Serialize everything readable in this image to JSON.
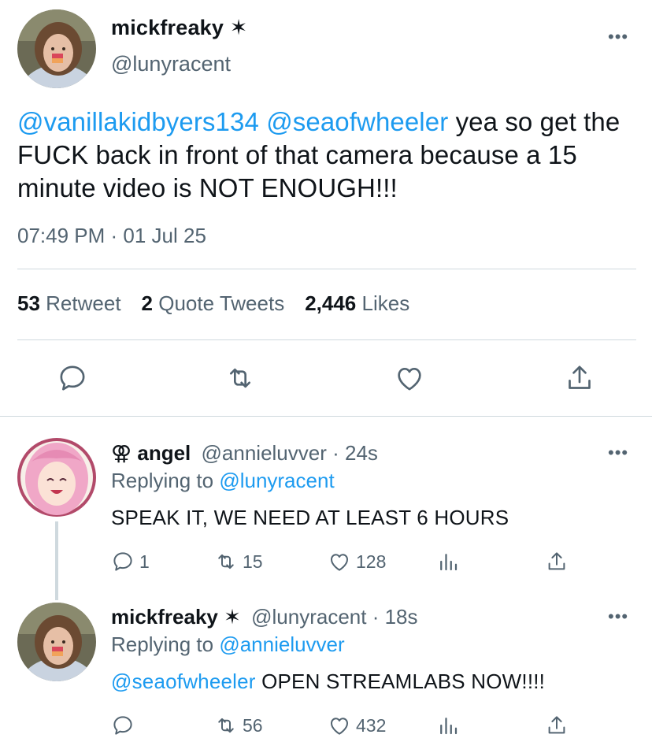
{
  "main_tweet": {
    "display_name": "mickfreaky ✶",
    "handle": "@lunyracent",
    "more": "•••",
    "text_mention_1": "@vanillakidbyers134",
    "text_mention_2": "@seaofwheeler",
    "text_rest": "yea so get the FUCK back in front of that camera because a 15 minute video is NOT ENOUGH!!!",
    "timestamp": "07:49 PM · 01 Jul 25",
    "stats": {
      "retweets_count": "53",
      "retweets_label": "Retweet",
      "quotes_count": "2",
      "quotes_label": "Quote Tweets",
      "likes_count": "2,446",
      "likes_label": "Likes"
    },
    "actions": [
      "reply-icon",
      "retweet-icon",
      "like-icon",
      "share-icon"
    ]
  },
  "replies": [
    {
      "display_name_icon": "⚢",
      "display_name": "angel",
      "handle": "@annieluvver",
      "time": "· 24s",
      "replying_prefix": "Replying to",
      "replying_to": "@lunyracent",
      "text_mention": "",
      "text": "SPEAK IT, WE NEED AT LEAST 6 HOURS",
      "reply_count": "1",
      "retweet_count": "15",
      "like_count": "128",
      "more": "•••"
    },
    {
      "display_name": "mickfreaky ✶",
      "handle": "@lunyracent",
      "time": "· 18s",
      "replying_prefix": "Replying to",
      "replying_to": "@annieluvver",
      "text_mention": "@seaofwheeler",
      "text": "OPEN STREAMLABS NOW!!!!",
      "reply_count": "",
      "retweet_count": "56",
      "like_count": "432",
      "more": "•••"
    }
  ],
  "colors": {
    "accent": "#1d9bf0",
    "muted": "#536471",
    "divider": "#cfd9de",
    "text": "#0f1419"
  }
}
